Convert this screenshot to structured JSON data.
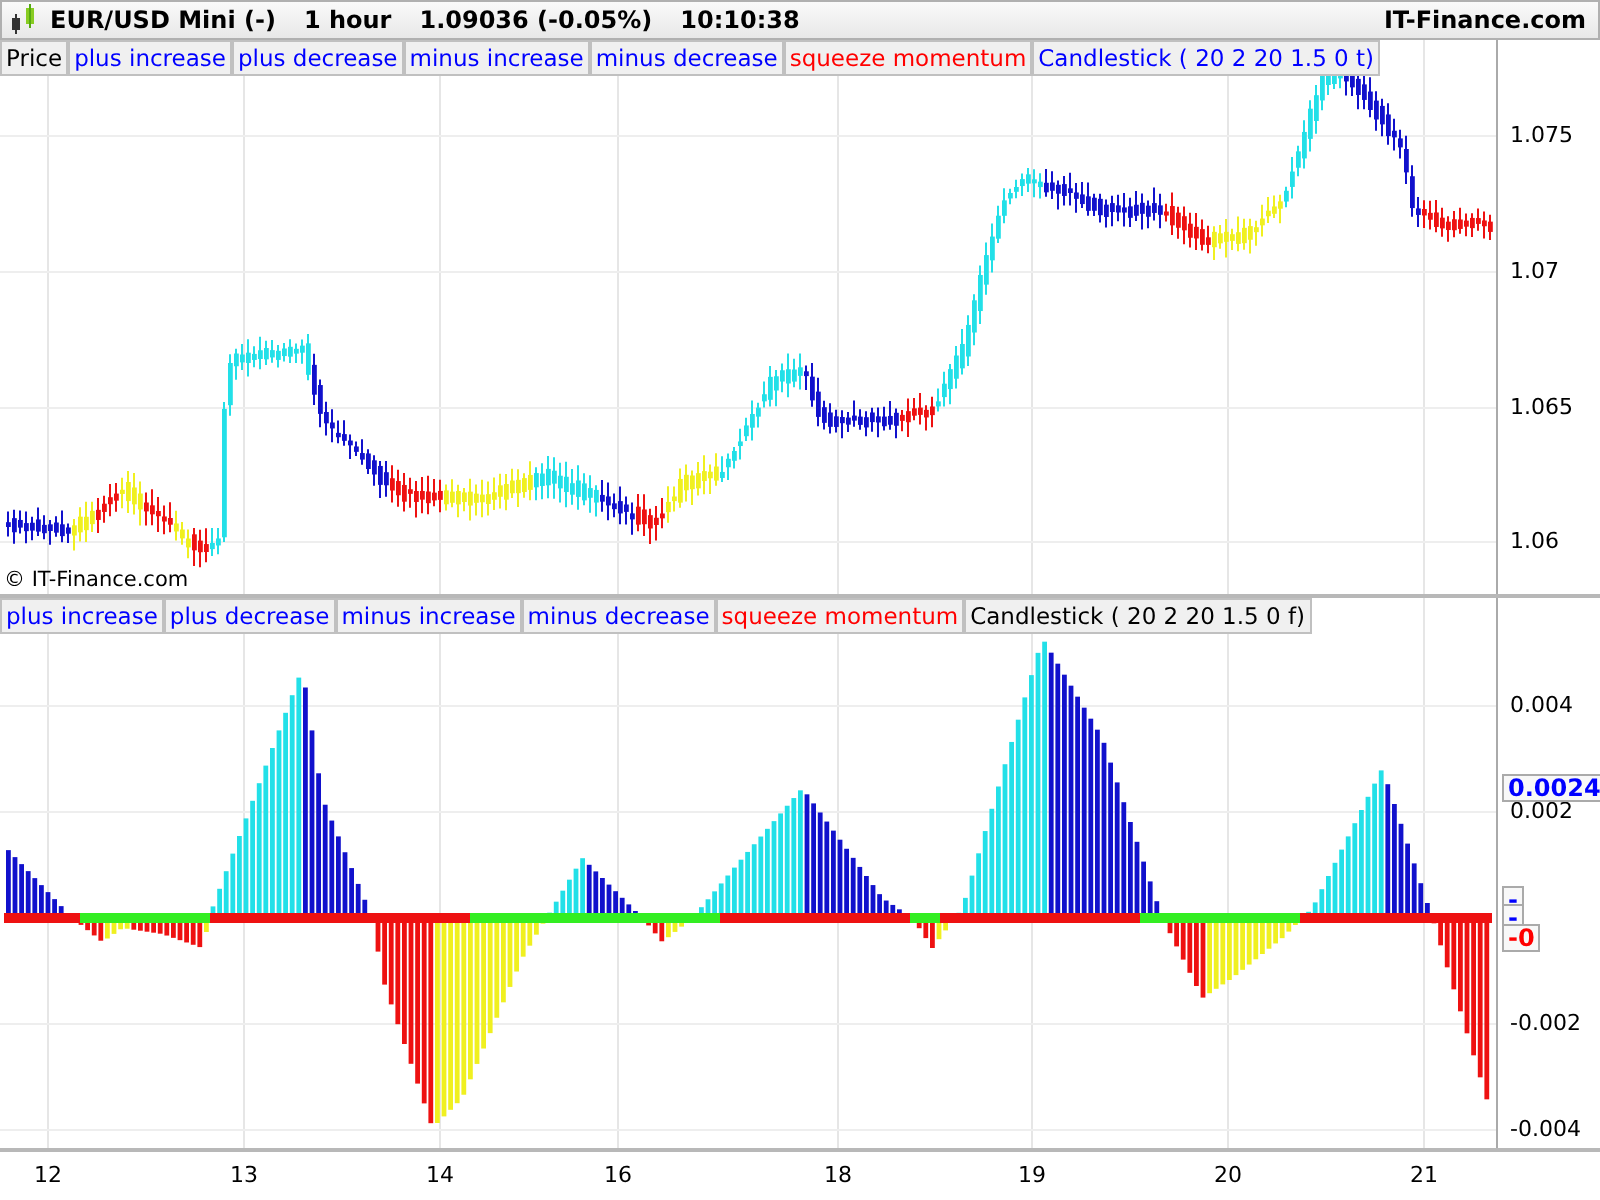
{
  "title_bar": {
    "symbol": "EUR/USD Mini (-)",
    "timeframe": "1 hour",
    "quote": "1.09036 (-0.05%)",
    "time": "10:10:38",
    "brand": "IT-Finance.com"
  },
  "price_panel": {
    "legend": [
      {
        "label": "Price",
        "color": "#000000"
      },
      {
        "label": "plus increase",
        "color": "#0000ff"
      },
      {
        "label": "plus decrease",
        "color": "#0000ff"
      },
      {
        "label": "minus increase",
        "color": "#0000ff"
      },
      {
        "label": "minus decrease",
        "color": "#0000ff"
      },
      {
        "label": "squeeze momentum",
        "color": "#ff0000"
      },
      {
        "label": "Candlestick ( 20 2 20 1.5 0 t)",
        "color": "#0000ff"
      }
    ],
    "y_axis": [
      "1.075",
      "1.07",
      "1.065",
      "1.06"
    ],
    "copyright": "© IT-Finance.com"
  },
  "indicator_panel": {
    "legend": [
      {
        "label": "plus increase",
        "color": "#0000ff"
      },
      {
        "label": "plus decrease",
        "color": "#0000ff"
      },
      {
        "label": "minus increase",
        "color": "#0000ff"
      },
      {
        "label": "minus decrease",
        "color": "#0000ff"
      },
      {
        "label": "squeeze momentum",
        "color": "#ff0000"
      },
      {
        "label": "Candlestick ( 20 2 20 1.5 0 f)",
        "color": "#000000"
      }
    ],
    "y_axis": [
      "0.004",
      "0.002",
      "-0.002",
      "-0.004"
    ],
    "markers": [
      {
        "label": "0.0024",
        "color": "#0000ff"
      },
      {
        "label": "-",
        "color": "#0000ff"
      },
      {
        "label": "-",
        "color": "#0000ff"
      },
      {
        "label": "-0",
        "color": "#ff0000"
      }
    ]
  },
  "x_axis": [
    "12",
    "13",
    "14",
    "16",
    "18",
    "19",
    "20",
    "21"
  ]
}
